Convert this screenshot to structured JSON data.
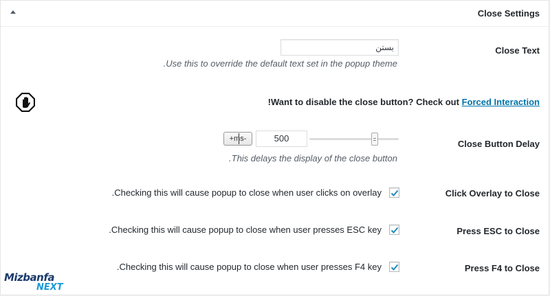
{
  "panel": {
    "title": "Close Settings"
  },
  "close_text": {
    "label": "Close Text",
    "value": "بستن",
    "description": ".Use this to override the default text set in the popup theme"
  },
  "notice": {
    "text": "!Want to disable the close button? Check out ",
    "link": "Forced Interaction"
  },
  "close_delay": {
    "label": "Close Button Delay",
    "unit": "+ms-",
    "value": "500",
    "slider_fraction": 0.73,
    "description": ".This delays the display of the close button"
  },
  "overlay": {
    "label": "Click Overlay to Close",
    "checked": true,
    "text": ".Checking this will cause popup to close when user clicks on overlay"
  },
  "esc": {
    "label": "Press ESC to Close",
    "checked": true,
    "text": ".Checking this will cause popup to close when user presses ESC key"
  },
  "f4": {
    "label": "Press F4 to Close",
    "checked": true,
    "text": ".Checking this will cause popup to close when user presses F4 key"
  },
  "logo": {
    "top": "Mizbanfa",
    "bottom": "NEXT"
  },
  "colors": {
    "link": "#0073aa",
    "checkmark": "#1e8cbe",
    "logo_primary": "#1b3a6b",
    "logo_accent": "#1a9bd7"
  },
  "icons": {
    "toggle": "caret-up-icon",
    "stop": "stop-hand-icon",
    "check": "check-icon"
  }
}
